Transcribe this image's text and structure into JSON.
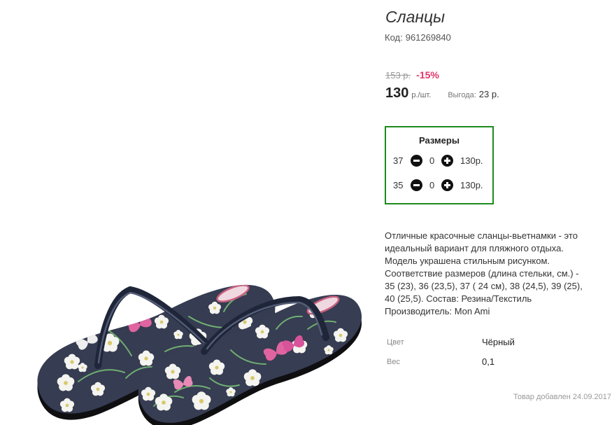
{
  "product": {
    "title": "Сланцы",
    "code_label": "Код:",
    "code": "961269840",
    "old_price": "153 р.",
    "discount": "-15%",
    "price": "130",
    "price_unit": "р./шт.",
    "benefit_label": "Выгода:",
    "benefit_value": "23 р."
  },
  "sizes": {
    "title": "Размеры",
    "rows": [
      {
        "size": "37",
        "quantity": "0",
        "price": "130р."
      },
      {
        "size": "35",
        "quantity": "0",
        "price": "130р."
      }
    ]
  },
  "description": [
    "Отличные красочные сланцы-вьетнамки - это",
    "идеальный вариант для пляжного отдыха.",
    "Модель украшена стильным рисунком.",
    "Соответствие размеров (длина стельки, см.) -",
    "35 (23), 36 (23,5), 37 ( 24 см), 38 (24,5), 39 (25),",
    "40 (25,5). Состав: Резина/Текстиль",
    "Производитель: Mon Ami"
  ],
  "properties": [
    {
      "label": "Цвет",
      "value": "Чёрный"
    },
    {
      "label": "Вес",
      "value": "0,1"
    }
  ],
  "added_date": "Товар добавлен 24.09.2017",
  "icons": {
    "decrease": "minus-circle-icon",
    "increase": "plus-circle-icon"
  },
  "colors": {
    "text": "#333333",
    "muted": "#999999",
    "discount": "#e2366a",
    "sizes_border": "#1e8a1e",
    "icon": "#111111"
  }
}
